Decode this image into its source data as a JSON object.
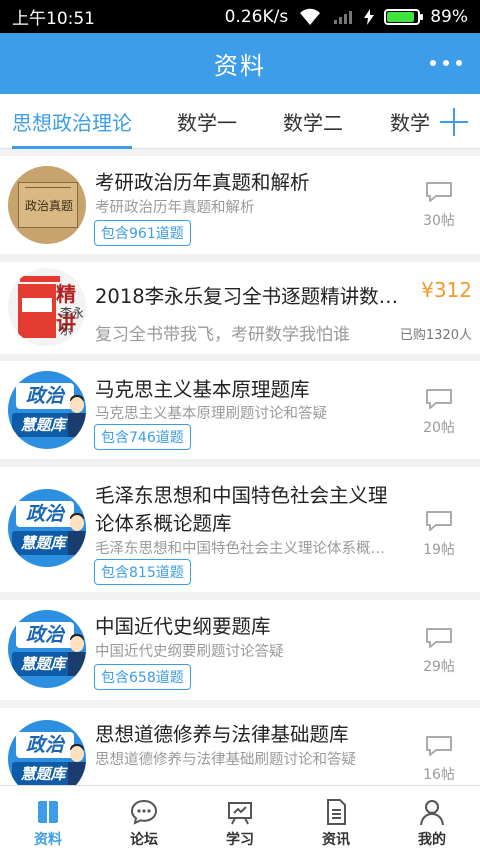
{
  "status": {
    "time": "上午10:51",
    "speed": "0.26K/s",
    "battery": "89%",
    "battery_level": 0.89
  },
  "header": {
    "title": "资料"
  },
  "tabs": [
    {
      "label": "思想政治理论",
      "active": true
    },
    {
      "label": "数学一"
    },
    {
      "label": "数学二"
    },
    {
      "label": "数学"
    }
  ],
  "items": [
    {
      "title": "考研政治历年真题和解析",
      "sub": "考研政治历年真题和解析",
      "badge": "包含961道题",
      "count": "30帖",
      "thumb_text": "政治真题"
    },
    {
      "title": "2018李永乐复习全书逐题精讲数…",
      "sub": "复习全书带我飞，考研数学我怕谁",
      "price": "¥312",
      "sold": "已购1320人",
      "thumb_text": "精讲",
      "thumb_text2": "李永乐"
    },
    {
      "title": "马克思主义基本原理题库",
      "sub": "马克思主义基本原理刷题讨论和答疑",
      "badge": "包含746道题",
      "count": "20帖"
    },
    {
      "title_l1": "毛泽东思想和中国特色社会主义理",
      "title_l2": "论体系概论题库",
      "sub": "毛泽东思想和中国特色社会主义理论体系概…",
      "badge": "包含815道题",
      "count": "19帖"
    },
    {
      "title": "中国近代史纲要题库",
      "sub": "中国近代史纲要刷题讨论答疑",
      "badge": "包含658道题",
      "count": "29帖"
    },
    {
      "title": "思想道德修养与法律基础题库",
      "sub": "思想道德修养与法律基础刷题讨论和答疑",
      "count": "16帖"
    }
  ],
  "thumb_labels": {
    "top": "政治",
    "bottom": "慧题库"
  },
  "nav": [
    {
      "label": "资料",
      "icon": "book-icon",
      "active": true
    },
    {
      "label": "论坛",
      "icon": "chat-icon"
    },
    {
      "label": "学习",
      "icon": "study-icon"
    },
    {
      "label": "资讯",
      "icon": "news-icon"
    },
    {
      "label": "我的",
      "icon": "user-icon"
    }
  ],
  "colors": {
    "accent": "#3d9de8",
    "price": "#f39a2b"
  }
}
